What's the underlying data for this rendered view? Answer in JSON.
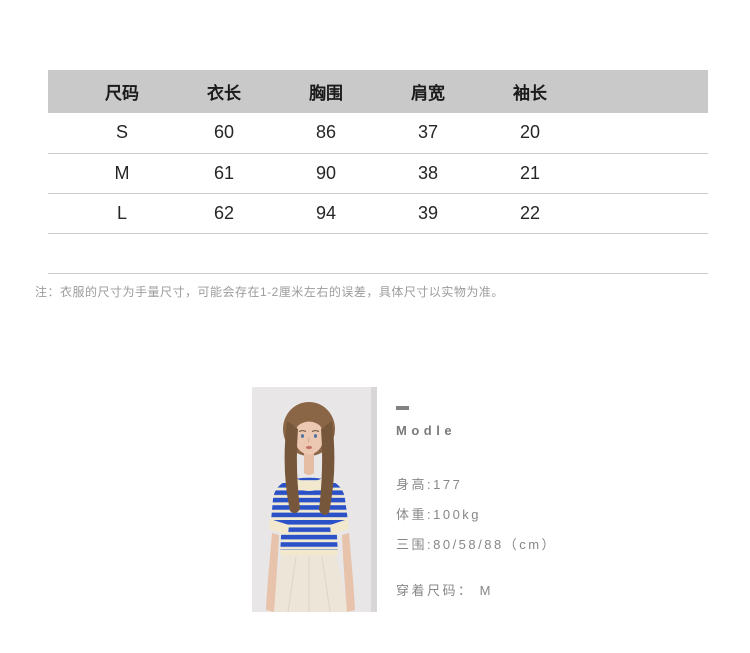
{
  "size_table": {
    "headers": [
      "尺码",
      "衣长",
      "胸围",
      "肩宽",
      "袖长"
    ],
    "rows": [
      {
        "cells": [
          "S",
          "60",
          "86",
          "37",
          "20"
        ]
      },
      {
        "cells": [
          "M",
          "61",
          "90",
          "38",
          "21"
        ]
      },
      {
        "cells": [
          "L",
          "62",
          "94",
          "39",
          "22"
        ]
      }
    ]
  },
  "note": {
    "text": "注：衣服的尺寸为手量尺寸，可能会存在1-2厘米左右的误差，具体尺寸以实物为准。"
  },
  "model_info": {
    "heading": "Modle",
    "height_line": "身高:177",
    "weight_line": "体重:100kg",
    "measurements_line": "三围:80/58/88（cm）",
    "wearing_line": "穿着尺码： M"
  },
  "colors": {
    "table_header_bg": "#c9c9c9",
    "table_border": "#cbcbcb",
    "note_text": "#9c9c9c",
    "model_text": "#878787",
    "photo_background": "#e8e6e7",
    "shirt_stripe_blue": "#2b51c9",
    "shirt_cream": "#f1ead2",
    "skirt_beige": "#ece5d8"
  }
}
